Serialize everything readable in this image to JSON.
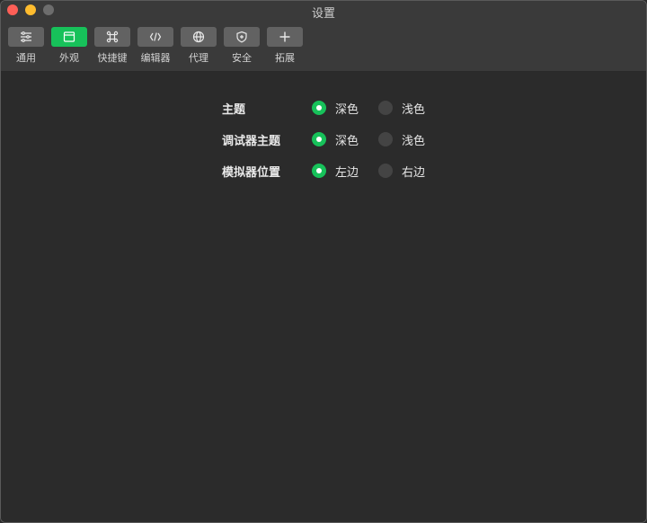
{
  "window": {
    "title": "设置"
  },
  "toolbar": {
    "tabs": [
      {
        "label": "通用",
        "icon": "sliders-icon",
        "active": false
      },
      {
        "label": "外观",
        "icon": "window-icon",
        "active": true
      },
      {
        "label": "快捷键",
        "icon": "command-icon",
        "active": false
      },
      {
        "label": "编辑器",
        "icon": "code-icon",
        "active": false
      },
      {
        "label": "代理",
        "icon": "globe-icon",
        "active": false
      },
      {
        "label": "安全",
        "icon": "shield-icon",
        "active": false
      },
      {
        "label": "拓展",
        "icon": "plus-icon",
        "active": false
      }
    ]
  },
  "settings": {
    "rows": [
      {
        "label": "主题",
        "options": [
          {
            "label": "深色",
            "selected": true
          },
          {
            "label": "浅色",
            "selected": false
          }
        ]
      },
      {
        "label": "调试器主题",
        "options": [
          {
            "label": "深色",
            "selected": true
          },
          {
            "label": "浅色",
            "selected": false
          }
        ]
      },
      {
        "label": "模拟器位置",
        "options": [
          {
            "label": "左边",
            "selected": true
          },
          {
            "label": "右边",
            "selected": false
          }
        ]
      }
    ]
  },
  "colors": {
    "accent": "#17c15a",
    "background": "#2b2b2b",
    "toolbar": "#3a3a3a"
  }
}
